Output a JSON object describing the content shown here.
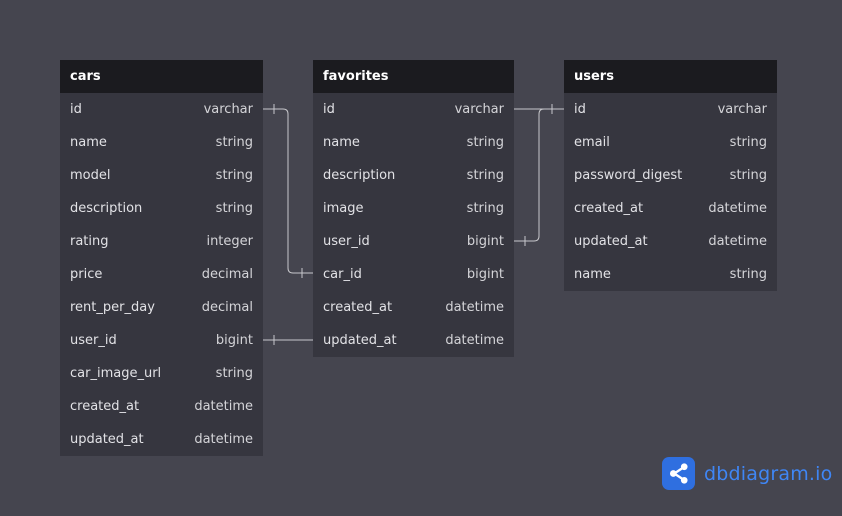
{
  "tables": {
    "cars": {
      "title": "cars",
      "fields": [
        {
          "name": "id",
          "type": "varchar"
        },
        {
          "name": "name",
          "type": "string"
        },
        {
          "name": "model",
          "type": "string"
        },
        {
          "name": "description",
          "type": "string"
        },
        {
          "name": "rating",
          "type": "integer"
        },
        {
          "name": "price",
          "type": "decimal"
        },
        {
          "name": "rent_per_day",
          "type": "decimal"
        },
        {
          "name": "user_id",
          "type": "bigint"
        },
        {
          "name": "car_image_url",
          "type": "string"
        },
        {
          "name": "created_at",
          "type": "datetime"
        },
        {
          "name": "updated_at",
          "type": "datetime"
        }
      ]
    },
    "favorites": {
      "title": "favorites",
      "fields": [
        {
          "name": "id",
          "type": "varchar"
        },
        {
          "name": "name",
          "type": "string"
        },
        {
          "name": "description",
          "type": "string"
        },
        {
          "name": "image",
          "type": "string"
        },
        {
          "name": "user_id",
          "type": "bigint"
        },
        {
          "name": "car_id",
          "type": "bigint"
        },
        {
          "name": "created_at",
          "type": "datetime"
        },
        {
          "name": "updated_at",
          "type": "datetime"
        }
      ]
    },
    "users": {
      "title": "users",
      "fields": [
        {
          "name": "id",
          "type": "varchar"
        },
        {
          "name": "email",
          "type": "string"
        },
        {
          "name": "password_digest",
          "type": "string"
        },
        {
          "name": "created_at",
          "type": "datetime"
        },
        {
          "name": "updated_at",
          "type": "datetime"
        },
        {
          "name": "name",
          "type": "string"
        }
      ]
    }
  },
  "relationships": [
    {
      "from": "cars.id",
      "to": "favorites.car_id"
    },
    {
      "from": "cars.user_id",
      "to": "favorites.updated_at"
    },
    {
      "from": "favorites.id",
      "to": "users.id"
    },
    {
      "from": "favorites.user_id",
      "to": "users.id"
    }
  ],
  "brand": {
    "name": "dbdiagram.io",
    "icon": "share-nodes-icon",
    "color": "#3f86f5"
  },
  "colors": {
    "background": "#45454f",
    "table_header": "#1b1b1f",
    "table_body": "#36363f",
    "connector": "#c8c8cc"
  }
}
